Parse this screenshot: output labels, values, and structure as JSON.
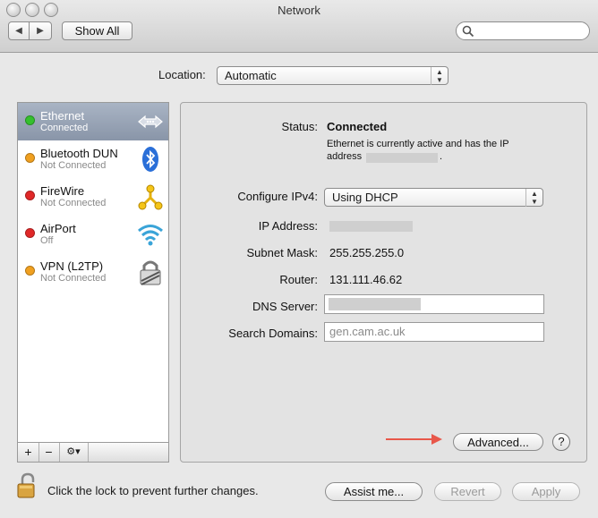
{
  "window": {
    "title": "Network"
  },
  "toolbar": {
    "show_all_label": "Show All",
    "back_icon": "chevron-left-icon",
    "forward_icon": "chevron-right-icon"
  },
  "location": {
    "label": "Location:",
    "value": "Automatic"
  },
  "services": [
    {
      "name": "Ethernet",
      "status": "Connected",
      "dot_color": "#35c02e",
      "icon": "ethernet-icon",
      "selected": true
    },
    {
      "name": "Bluetooth DUN",
      "status": "Not Connected",
      "dot_color": "#f0a020",
      "icon": "bluetooth-icon",
      "selected": false
    },
    {
      "name": "FireWire",
      "status": "Not Connected",
      "dot_color": "#e02828",
      "icon": "firewire-icon",
      "selected": false
    },
    {
      "name": "AirPort",
      "status": "Off",
      "dot_color": "#e02828",
      "icon": "airport-wifi-icon",
      "selected": false
    },
    {
      "name": "VPN (L2TP)",
      "status": "Not Connected",
      "dot_color": "#f0a020",
      "icon": "vpn-lock-icon",
      "selected": false
    }
  ],
  "list_buttons": {
    "add": "+",
    "remove": "−",
    "action": "⚙▾"
  },
  "detail": {
    "status_label": "Status:",
    "status_value": "Connected",
    "status_desc_line1": "Ethernet is currently active and has the IP",
    "status_desc_line2": "address",
    "status_desc_end": ".",
    "configure_label": "Configure IPv4:",
    "configure_value": "Using DHCP",
    "ip_label": "IP Address:",
    "subnet_label": "Subnet Mask:",
    "subnet_value": "255.255.255.0",
    "router_label": "Router:",
    "router_value": "131.111.46.62",
    "dns_label": "DNS Server:",
    "dns_value": "",
    "search_label": "Search Domains:",
    "search_value": "gen.cam.ac.uk",
    "advanced_label": "Advanced...",
    "help_label": "?"
  },
  "footer": {
    "lock_text": "Click the lock to prevent further changes.",
    "assist_label": "Assist me...",
    "revert_label": "Revert",
    "apply_label": "Apply"
  },
  "colors": {
    "arrow": "#e8574a",
    "selection": "#8995a8"
  }
}
